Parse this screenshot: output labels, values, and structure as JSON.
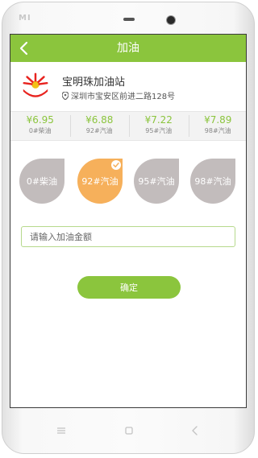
{
  "device": {
    "brand": "MI"
  },
  "header": {
    "title": "加油",
    "back_icon": "chevron-left-icon"
  },
  "station": {
    "name": "宝明珠加油站",
    "address": "深圳市宝安区前进二路128号",
    "logo_icon": "sinopec-style-logo",
    "location_icon": "location-pin-icon"
  },
  "prices": [
    {
      "value": "¥6.95",
      "label": "0#柴油"
    },
    {
      "value": "¥6.88",
      "label": "92#汽油"
    },
    {
      "value": "¥7.22",
      "label": "95#汽油"
    },
    {
      "value": "¥7.89",
      "label": "98#汽油"
    }
  ],
  "fuels": [
    {
      "label": "0#柴油",
      "selected": false
    },
    {
      "label": "92#汽油",
      "selected": true
    },
    {
      "label": "95#汽油",
      "selected": false
    },
    {
      "label": "98#汽油",
      "selected": false
    }
  ],
  "amount": {
    "placeholder": "请输入加油金额",
    "value": ""
  },
  "confirm_label": "确定",
  "colors": {
    "accent": "#8bc53d",
    "selected": "#f6b05b",
    "unselected": "#c2bcbc"
  }
}
